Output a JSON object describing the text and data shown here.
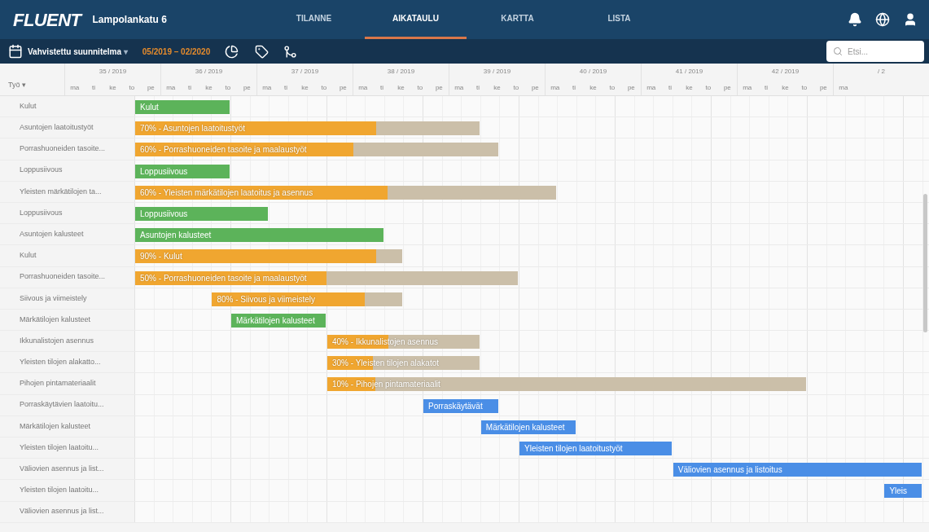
{
  "header": {
    "logo": "FLUENT",
    "project": "Lampolankatu 6",
    "tabs": [
      {
        "label": "TILANNE",
        "selected": false
      },
      {
        "label": "AIKATAULU",
        "selected": true
      },
      {
        "label": "KARTTA",
        "selected": false
      },
      {
        "label": "LISTA",
        "selected": false
      }
    ]
  },
  "toolbar": {
    "plan": "Vahvistettu suunnitelma",
    "plan_caret": "▾",
    "date_range": "05/2019 – 02/2020",
    "search": {
      "placeholder": "Etsi..."
    }
  },
  "gantt": {
    "column_header": "Työ ▾",
    "weeks": [
      {
        "label": "35 / 2019",
        "days": [
          "ma",
          "ti",
          "ke",
          "to",
          "pe"
        ]
      },
      {
        "label": "36 / 2019",
        "days": [
          "ma",
          "ti",
          "ke",
          "to",
          "pe"
        ]
      },
      {
        "label": "37 / 2019",
        "days": [
          "ma",
          "ti",
          "ke",
          "to",
          "pe"
        ]
      },
      {
        "label": "38 / 2019",
        "days": [
          "ma",
          "ti",
          "ke",
          "to",
          "pe"
        ]
      },
      {
        "label": "39 / 2019",
        "days": [
          "ma",
          "ti",
          "ke",
          "to",
          "pe"
        ]
      },
      {
        "label": "40 / 2019",
        "days": [
          "ma",
          "ti",
          "ke",
          "to",
          "pe"
        ]
      },
      {
        "label": "41 / 2019",
        "days": [
          "ma",
          "ti",
          "ke",
          "to",
          "pe"
        ]
      },
      {
        "label": "42 / 2019",
        "days": [
          "ma",
          "ti",
          "ke",
          "to",
          "pe"
        ]
      },
      {
        "label": "/ 2",
        "days": [
          "ma"
        ]
      }
    ],
    "rows": [
      {
        "label": "Kulut",
        "bar": {
          "kind": "plain",
          "label": "Kulut",
          "color": "#5cb35a"
        }
      },
      {
        "label": "Asuntojen laatoitustyöt",
        "bar": {
          "kind": "progress",
          "label": "70% - Asuntojen laatoitustyöt",
          "color": "#f0a630",
          "level": 0.7
        }
      },
      {
        "label": "Porrashuoneiden tasoite...",
        "bar": {
          "kind": "progress",
          "label": "60% - Porrashuoneiden tasoite ja maalaustyöt",
          "color": "#f0a630",
          "level": 0.6
        }
      },
      {
        "label": "Loppusiivous",
        "bar": {
          "kind": "plain",
          "label": "Loppusiivous",
          "color": "#5cb35a"
        }
      },
      {
        "label": "Yleisten märkätilojen ta...",
        "bar": {
          "kind": "progress",
          "label": "60% - Yleisten märkätilojen laatoitus ja asennus",
          "color": "#f0a630",
          "level": 0.6
        }
      },
      {
        "label": "Loppusiivous",
        "bar": {
          "kind": "plain",
          "label": "Loppusiivous",
          "color": "#5cb35a"
        }
      },
      {
        "label": "Asuntojen kalusteet",
        "bar": {
          "kind": "plain",
          "label": "Asuntojen kalusteet",
          "color": "#5cb35a"
        }
      },
      {
        "label": "Kulut",
        "bar": {
          "kind": "progress",
          "label": "90% - Kulut",
          "color": "#f0a630",
          "level": 0.9
        }
      },
      {
        "label": "Porrashuoneiden tasoite...",
        "bar": {
          "kind": "progress",
          "label": "50% - Porrashuoneiden tasoite ja maalaustyöt",
          "color": "#f0a630",
          "level": 0.5
        }
      },
      {
        "label": "Siivous ja viimeistely",
        "bar": {
          "kind": "progress",
          "label": "80% - Siivous ja viimeistely",
          "color": "#f0a630",
          "level": 0.8
        }
      },
      {
        "label": "Märkätilojen kalusteet",
        "bar": {
          "kind": "plain",
          "label": "Märkätilojen kalusteet",
          "color": "#5cb35a"
        }
      },
      {
        "label": "Ikkunalistojen asennus",
        "bar": {
          "kind": "progress",
          "label": "40% - Ikkunalistojen asennus",
          "color": "#f0a630",
          "level": 0.4
        }
      },
      {
        "label": "Yleisten tilojen alakatto...",
        "bar": {
          "kind": "progress",
          "label": "30% - Yleisten tilojen alakatot",
          "color": "#f0a630",
          "level": 0.3
        }
      },
      {
        "label": "Pihojen pintamateriaalit",
        "bar": {
          "kind": "progress",
          "label": "10% - Pihojen pintamateriaalit",
          "color": "#f0a630",
          "level": 0.1
        }
      },
      {
        "label": "Porraskäytävien laatoitu...",
        "bar": {
          "kind": "plain",
          "label": "Porraskäytävät",
          "color": "#4a8ee6"
        }
      },
      {
        "label": "Märkätilojen kalusteet",
        "bar": {
          "kind": "plain",
          "label": "Märkätilojen kalusteet",
          "color": "#4a8ee6"
        }
      },
      {
        "label": "Yleisten tilojen laatoitu...",
        "bar": {
          "kind": "plain",
          "label": "Yleisten tilojen laatoitustyöt",
          "color": "#4a8ee6"
        }
      },
      {
        "label": "Väliovien asennus ja list...",
        "bar": {
          "kind": "plain",
          "label": "Väliovien asennus ja listoitus",
          "color": "#4a8ee6"
        }
      },
      {
        "label": "Yleisten tilojen laatoitu...",
        "bar": {
          "kind": "plain",
          "label": "Yleis",
          "color": "#4a8ee6"
        }
      },
      {
        "label": "Väliovien asennus ja list..."
      }
    ]
  }
}
